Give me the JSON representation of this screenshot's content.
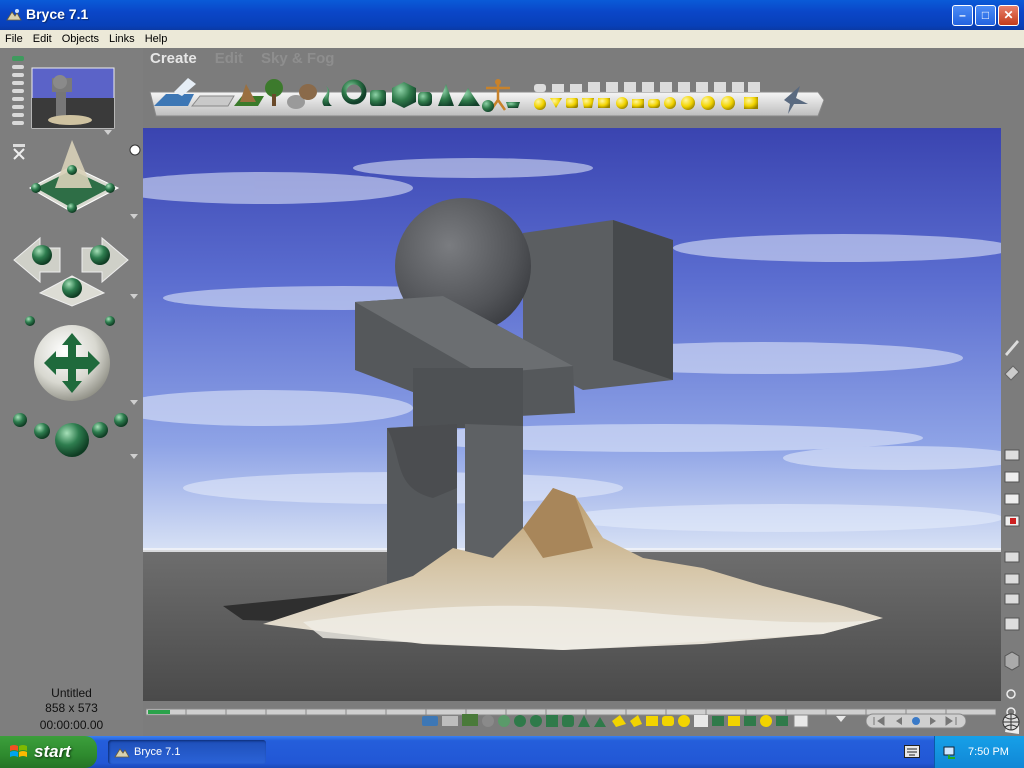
{
  "window": {
    "title": "Bryce 7.1",
    "minimize": "–",
    "maximize": "□",
    "close": "✕"
  },
  "menu": [
    "File",
    "Edit",
    "Objects",
    "Links",
    "Help"
  ],
  "tabs": {
    "create": "Create",
    "edit": "Edit",
    "sky": "Sky & Fog"
  },
  "document": {
    "name": "Untitled",
    "dimensions": "858 x 573",
    "time": "00:00:00.00"
  },
  "taskbar": {
    "start": "start",
    "window_item": "Bryce 7.1",
    "clock": "7:50 PM"
  },
  "colors": {
    "sky_top": "#3a44b0",
    "sky_mid": "#7a8ee0",
    "ground": "#4e4e4e",
    "object_gray": "#5b5e61",
    "toolbar_green": "#2f7a4a",
    "toolbar_yellow": "#f2d400"
  }
}
